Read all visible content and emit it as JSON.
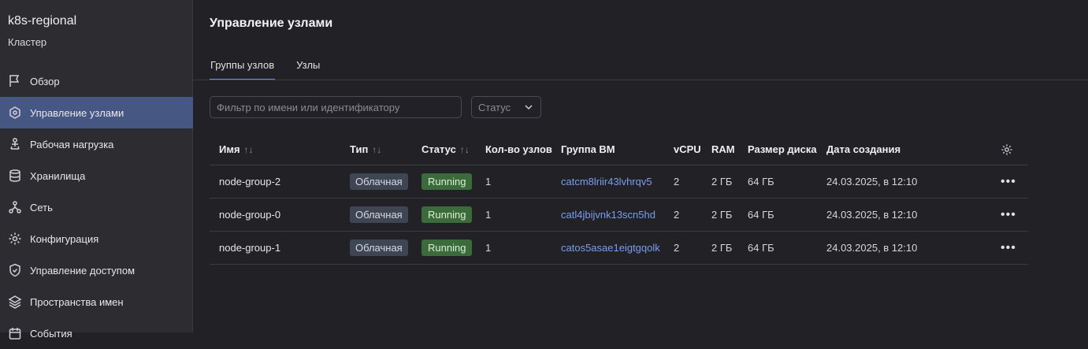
{
  "cluster": {
    "name": "k8s-regional",
    "subtitle": "Кластер"
  },
  "sidebar": {
    "items": [
      {
        "label": "Обзор",
        "icon": "flag-icon",
        "active": false
      },
      {
        "label": "Управление узлами",
        "icon": "nodes-icon",
        "active": true
      },
      {
        "label": "Рабочая нагрузка",
        "icon": "workload-icon",
        "active": false
      },
      {
        "label": "Хранилища",
        "icon": "database-icon",
        "active": false
      },
      {
        "label": "Сеть",
        "icon": "network-icon",
        "active": false
      },
      {
        "label": "Конфигурация",
        "icon": "gear-icon",
        "active": false
      },
      {
        "label": "Управление доступом",
        "icon": "shield-icon",
        "active": false
      },
      {
        "label": "Пространства имен",
        "icon": "layers-icon",
        "active": false
      },
      {
        "label": "События",
        "icon": "calendar-icon",
        "active": false
      }
    ]
  },
  "page": {
    "title": "Управление узлами"
  },
  "tabs": [
    {
      "label": "Группы узлов",
      "active": true
    },
    {
      "label": "Узлы",
      "active": false
    }
  ],
  "filter": {
    "placeholder": "Фильтр по имени или идентификатору",
    "value": ""
  },
  "status_select": {
    "placeholder": "Статус"
  },
  "table": {
    "columns": {
      "name": "Имя",
      "type": "Тип",
      "status": "Статус",
      "count": "Кол-во узлов",
      "vm_group": "Группа ВМ",
      "vcpu": "vCPU",
      "ram": "RAM",
      "disk": "Размер диска",
      "created": "Дата создания"
    },
    "rows": [
      {
        "name": "node-group-2",
        "type": "Облачная",
        "status": "Running",
        "count": "1",
        "vm_group": "catcm8lriir43lvhrqv5",
        "vcpu": "2",
        "ram": "2 ГБ",
        "disk": "64 ГБ",
        "created": "24.03.2025, в 12:10"
      },
      {
        "name": "node-group-0",
        "type": "Облачная",
        "status": "Running",
        "count": "1",
        "vm_group": "catl4jbijvnk13scn5hd",
        "vcpu": "2",
        "ram": "2 ГБ",
        "disk": "64 ГБ",
        "created": "24.03.2025, в 12:10"
      },
      {
        "name": "node-group-1",
        "type": "Облачная",
        "status": "Running",
        "count": "1",
        "vm_group": "catos5asae1eigtgqolk",
        "vcpu": "2",
        "ram": "2 ГБ",
        "disk": "64 ГБ",
        "created": "24.03.2025, в 12:10"
      }
    ]
  },
  "colors": {
    "accent": "#465783",
    "link": "#7b9cf0",
    "running": "#3b6b3a"
  }
}
